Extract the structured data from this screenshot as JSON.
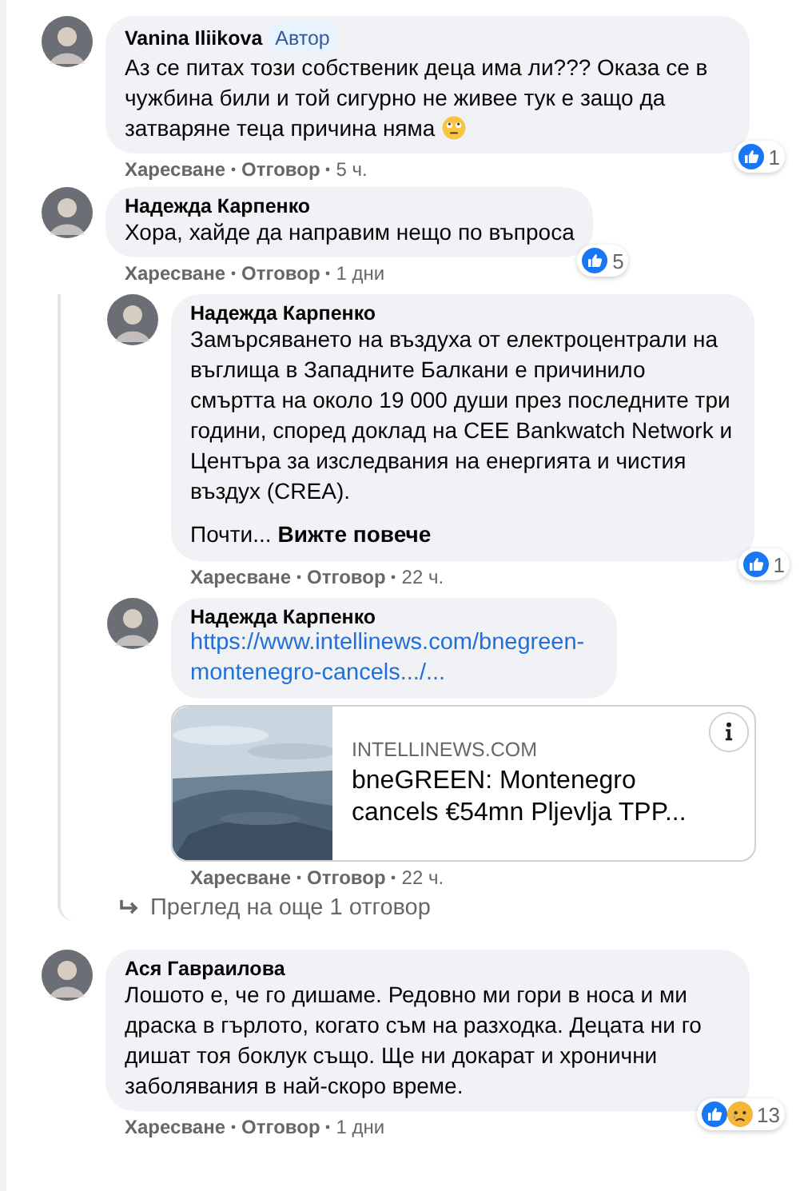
{
  "comments": [
    {
      "author": "Vanina Iliikova",
      "badge": "Автор",
      "text": "Аз се питах този собственик деца има ли??? Оказа се в чужбина били и той сигурно не живее тук е защо да затваряне теца причина няма",
      "trailing_emoji": true,
      "reactions": [
        {
          "kind": "like"
        }
      ],
      "reaction_count": "1",
      "actions": [
        "Харесване",
        "Отговор"
      ],
      "time": "5 ч."
    },
    {
      "author": "Надежда Карпенко",
      "text": "Хора, хайде да направим нещо по въпроса",
      "reactions": [
        {
          "kind": "like"
        }
      ],
      "reaction_count": "5",
      "actions": [
        "Харесване",
        "Отговор"
      ],
      "time": "1 дни",
      "replies": [
        {
          "author": "Надежда Карпенко",
          "text": "Замърсяването на въздуха от електроцентрали на въглища в Западните Балкани е причинило смъртта на около 19 000 души през последните три години, според доклад на CEE Bankwatch Network и Центъра за изследвания на енергията и чистия въздух (CREA).",
          "more": {
            "prefix": "Почти...",
            "link": "Вижте повече"
          },
          "reactions": [
            {
              "kind": "like"
            }
          ],
          "reaction_count": "1",
          "actions": [
            "Харесване",
            "Отговор"
          ],
          "time": "22 ч."
        },
        {
          "author": "Надежда Карпенко",
          "link": "https://www.intellinews.com/bnegreen-montenegro-cancels.../...",
          "preview": {
            "kind": "picture",
            "domain": "INTELLINEWS.COM",
            "title": "bneGREEN: Montenegro cancels €54mn Pljevlja TPP..."
          },
          "actions": [
            "Харесване",
            "Отговор"
          ],
          "time": "22 ч."
        }
      ],
      "more_replies": "Преглед на още 1 отговор"
    },
    {
      "author": "Ася Гавраилова",
      "text": "Лошото е, че го дишаме. Редовно ми гори в носа и ми драска в гърлото, когато съм на разходка. Децата ни го дишат тоя боклук също. Ще ни докарат и хронични заболявания в най-скоро време.",
      "reactions": [
        {
          "kind": "like"
        },
        {
          "kind": "sad"
        }
      ],
      "reaction_count": "13",
      "actions": [
        "Харесване",
        "Отговор"
      ],
      "time": "1 дни"
    }
  ]
}
